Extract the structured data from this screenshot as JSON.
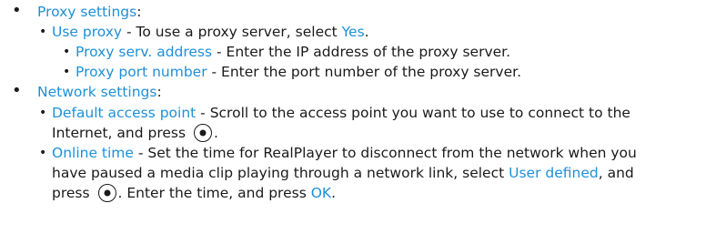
{
  "bullets": {
    "level1": "•",
    "level2": "•",
    "level3": "•"
  },
  "proxy": {
    "heading": "Proxy settings",
    "colon": ":",
    "use_proxy": {
      "term": "Use proxy",
      "text": " - To use a proxy server, select ",
      "value": "Yes",
      "end": "."
    },
    "address": {
      "term": "Proxy serv. address",
      "text": " - Enter the IP address of the proxy server."
    },
    "port": {
      "term": "Proxy port number",
      "text": " - Enter the port number of the proxy server."
    }
  },
  "network": {
    "heading": "Network settings",
    "colon": ":",
    "access_point": {
      "term": "Default access point",
      "text_line1": " - Scroll to the access point you want to use to connect to the",
      "text_line2": "Internet, and press ",
      "end": "."
    },
    "online_time": {
      "term": "Online time",
      "text_line1": " - Set the time for RealPlayer to disconnect from the network when you",
      "text_line2a": "have paused a media clip playing through a network link, select ",
      "value": "User defined",
      "text_line2b": ", and",
      "text_line3a": "press ",
      "text_line3b": ". Enter the time, and press ",
      "ok": "OK",
      "end": "."
    }
  },
  "colors": {
    "term": "#1e90d8",
    "text": "#1a1a1a"
  },
  "icons": {
    "select_key": "select-key-icon"
  }
}
